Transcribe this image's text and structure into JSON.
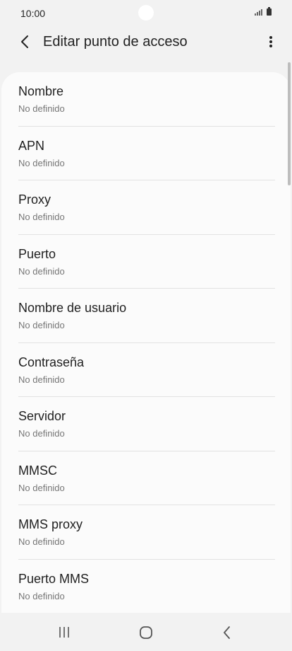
{
  "status": {
    "time": "10:00"
  },
  "header": {
    "title": "Editar punto de acceso"
  },
  "settings": {
    "items": [
      {
        "label": "Nombre",
        "value": "No definido"
      },
      {
        "label": "APN",
        "value": "No definido"
      },
      {
        "label": "Proxy",
        "value": "No definido"
      },
      {
        "label": "Puerto",
        "value": "No definido"
      },
      {
        "label": "Nombre de usuario",
        "value": "No definido"
      },
      {
        "label": "Contraseña",
        "value": "No definido"
      },
      {
        "label": "Servidor",
        "value": "No definido"
      },
      {
        "label": "MMSC",
        "value": "No definido"
      },
      {
        "label": "MMS proxy",
        "value": "No definido"
      },
      {
        "label": "Puerto MMS",
        "value": "No definido"
      }
    ]
  },
  "icons": {
    "back": "back-arrow-icon",
    "more": "more-vertical-icon",
    "nav_recents": "recents-icon",
    "nav_home": "home-icon",
    "nav_back": "back-icon"
  }
}
